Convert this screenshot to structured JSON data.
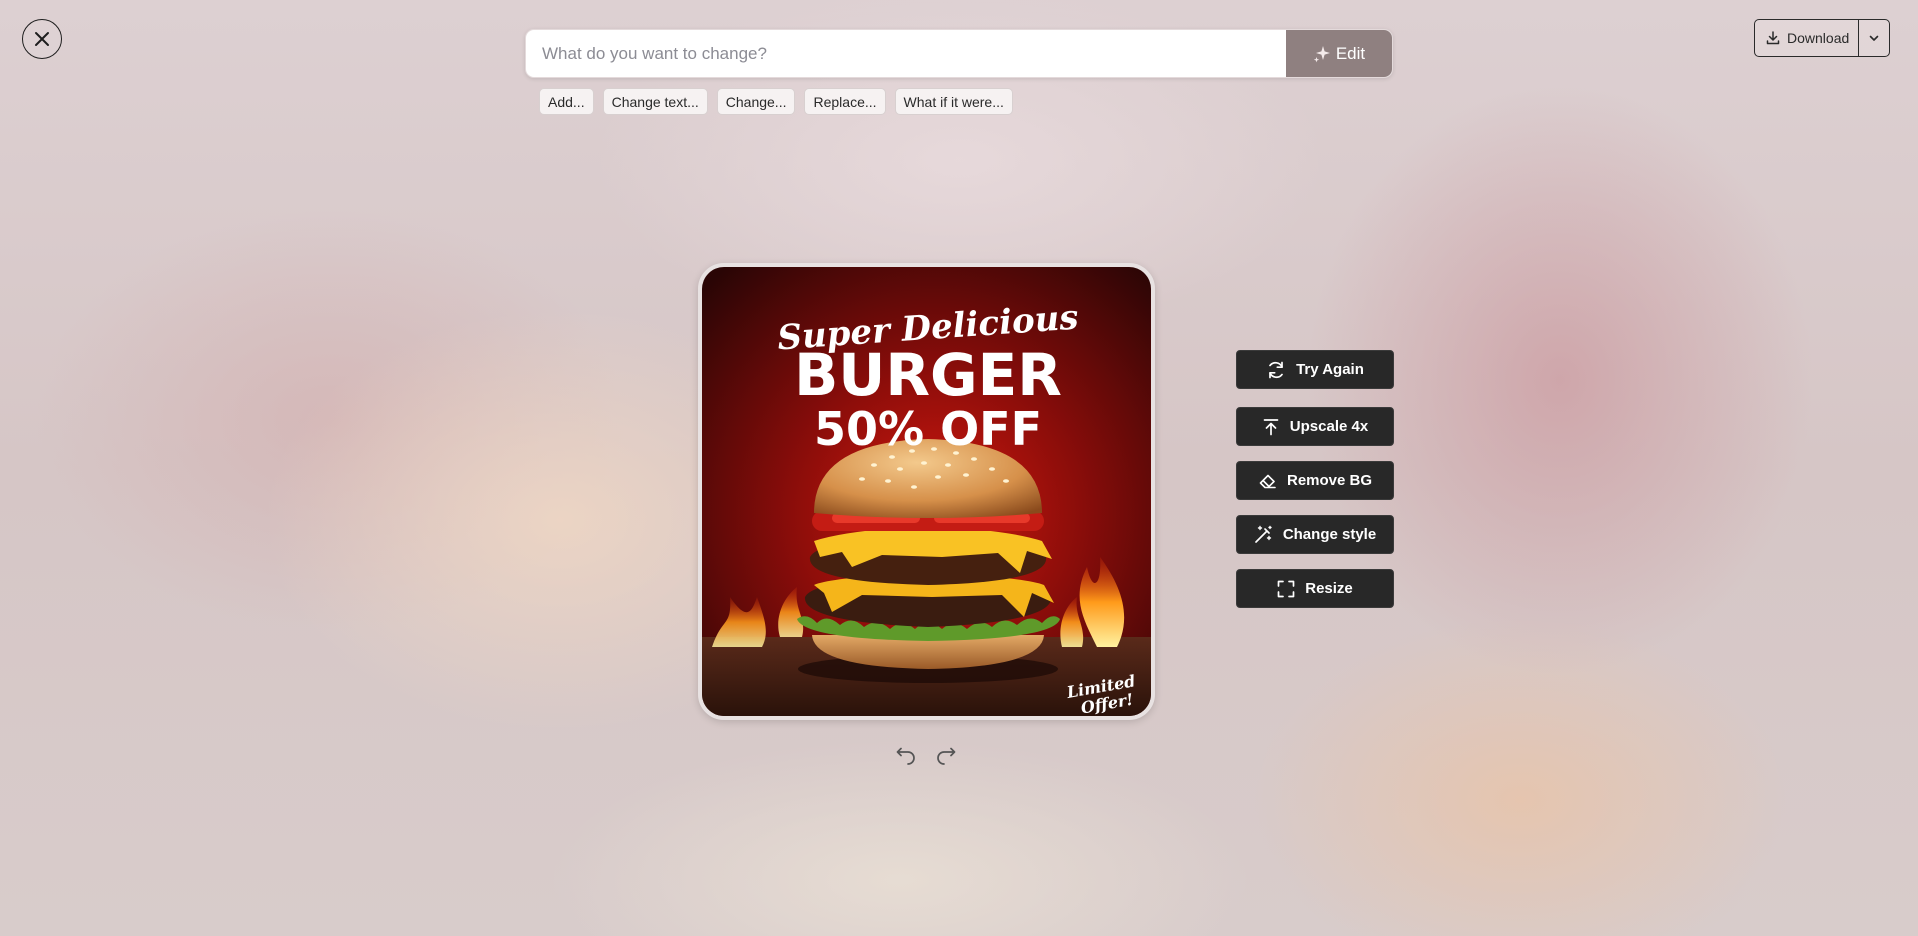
{
  "search": {
    "placeholder": "What do you want to change?",
    "edit_label": "Edit"
  },
  "suggestions": [
    "Add...",
    "Change text...",
    "Change...",
    "Replace...",
    "What if it were..."
  ],
  "download": {
    "label": "Download"
  },
  "poster": {
    "line1": "Super Delicious",
    "line2": "BURGER",
    "line3": "50% OFF",
    "badge_line1": "Limited",
    "badge_line2": "Offer!"
  },
  "actions": {
    "try_again": "Try Again",
    "upscale": "Upscale 4x",
    "remove_bg": "Remove BG",
    "change_style": "Change style",
    "resize": "Resize"
  },
  "icons": {
    "close": "close-icon",
    "sparkle": "sparkle-icon",
    "download": "download-icon",
    "chevron": "chevron-down-icon",
    "refresh": "refresh-icon",
    "upscale": "arrow-up-bar-icon",
    "eraser": "eraser-icon",
    "wand": "magic-wand-icon",
    "resize": "resize-corners-icon",
    "undo": "undo-icon",
    "redo": "redo-icon"
  },
  "colors": {
    "action_bg": "#282828",
    "edit_bg": "#8f8080",
    "poster_bg": "#7a0c0c"
  }
}
